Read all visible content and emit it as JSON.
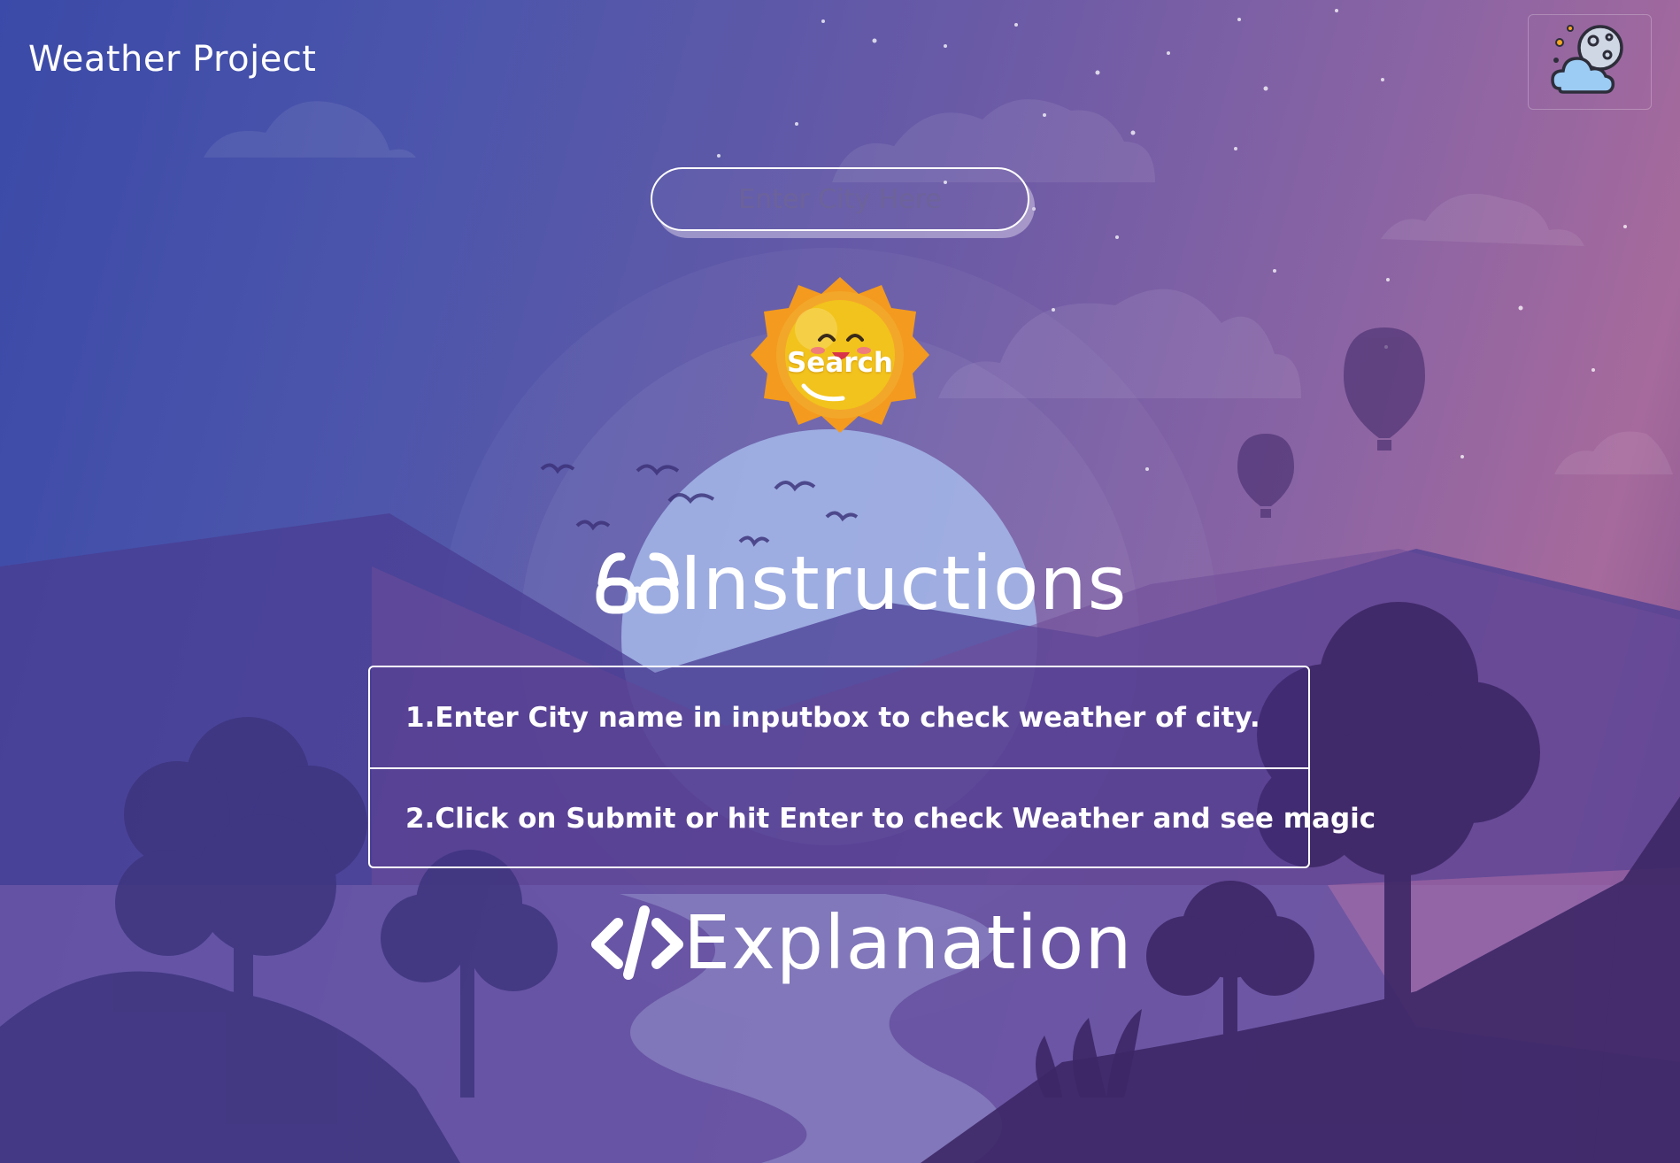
{
  "header": {
    "title": "Weather Project",
    "mode_toggle_icon": "moon-cloud-icon"
  },
  "search": {
    "placeholder": "Enter City Here",
    "value": "",
    "button_label": "Search",
    "button_icon": "smiling-sun-icon"
  },
  "instructions": {
    "title": "Instructions",
    "title_icon": "glasses-icon",
    "items": [
      "1.Enter City name in inputbox to check weather of city.",
      "2.Click on Submit or hit Enter to check Weather and see magic"
    ]
  },
  "explanation": {
    "title": "Explanation",
    "title_icon": "code-icon"
  },
  "colors": {
    "background_left": "#3b4aa8",
    "background_right": "#a66a9c",
    "sun_yellow": "#f2c31c",
    "sun_orange": "#f39a1f",
    "text": "#ffffff"
  }
}
